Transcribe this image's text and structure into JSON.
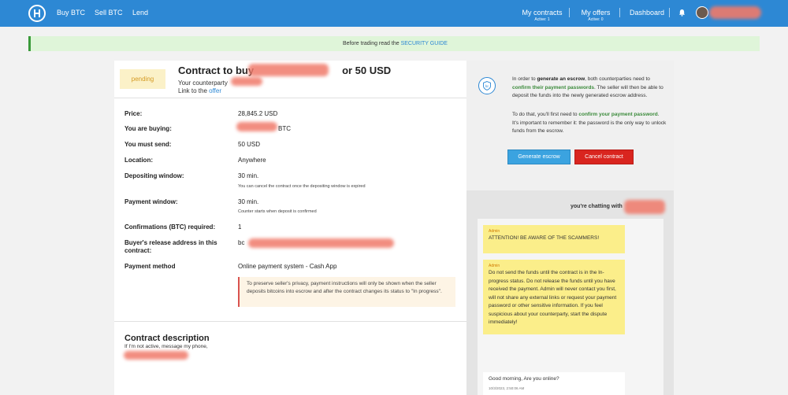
{
  "nav": {
    "links": [
      "Buy BTC",
      "Sell BTC",
      "Lend"
    ],
    "my_contracts": "My contracts",
    "contracts_active": "Active: 1",
    "my_offers": "My offers",
    "offers_active": "Active: 0",
    "dashboard": "Dashboard"
  },
  "banner": {
    "prefix": "Before trading read the ",
    "link": "SECURITY GUIDE"
  },
  "contract": {
    "status": "pending",
    "title_prefix": "Contract to buy",
    "title_suffix": "or 50 USD",
    "counterparty": "Your counterparty",
    "link_to": "Link to the ",
    "offer": "offer"
  },
  "details": [
    {
      "label": "Price:",
      "value": "28,845.2 USD"
    },
    {
      "label": "You are buying:",
      "value": "BTC"
    },
    {
      "label": "You must send:",
      "value": "50 USD"
    },
    {
      "label": "Location:",
      "value": "Anywhere"
    },
    {
      "label": "Depositing window:",
      "value": "30 min.",
      "note": "You can cancel the contract once the depositing window is expired"
    },
    {
      "label": "Payment window:",
      "value": "30 min.",
      "note": "Counter starts when deposit is confirmed"
    },
    {
      "label": "Confirmations (BTC) required:",
      "value": "1"
    },
    {
      "label": "Buyer's release address in this",
      "label2": "contract:",
      "value": "bc"
    },
    {
      "label": "Payment method",
      "value": "Online payment system - Cash App"
    }
  ],
  "privacy_note": "To preserve seller's privacy, payment instructions will only be shown when the seller deposits bitcoins into escrow and after the contract changes its status to \"In progress\".",
  "description": {
    "title": "Contract description",
    "text": "If I'm not active, message my phone,"
  },
  "escrow": {
    "p1_a": "In order to ",
    "p1_b": "generate an escrow",
    "p1_c": ", both counterparties need to ",
    "p1_d": "confirm their payment passwords",
    "p1_e": ". The seller will then be able to deposit the funds into the newly generated escrow address.",
    "p2_a": "To do that, you'll first need to ",
    "p2_b": "confirm your payment password",
    "p2_c": ". It's important to remember it: the password is the only way to unlock funds from the escrow.",
    "generate_button": "Generate escrow",
    "cancel_button": "Cancel contract"
  },
  "chat": {
    "header": "you're chatting with",
    "messages": [
      {
        "sender": "Admin",
        "text": "ATTENTION! BE AWARE OF THE SCAMMERS!"
      },
      {
        "sender": "Admin",
        "text": "Do not send the funds until the contract is in the In-progress status. Do not release the funds until you have received the payment. Admin will never contact you first, will not share any external links or request your payment password or other sensitive information. If you feel suspicious about your counterparty, start the dispute immediately!"
      },
      {
        "text": "Good morning, Are you online?",
        "time": "10/3/2023, 2:50:06 AM"
      }
    ]
  }
}
